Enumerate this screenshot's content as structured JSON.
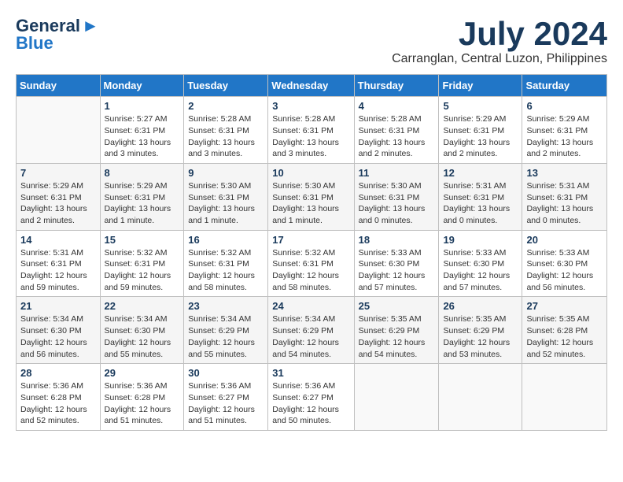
{
  "header": {
    "logo_line1": "General",
    "logo_line2": "Blue",
    "month_year": "July 2024",
    "location": "Carranglan, Central Luzon, Philippines"
  },
  "days_of_week": [
    "Sunday",
    "Monday",
    "Tuesday",
    "Wednesday",
    "Thursday",
    "Friday",
    "Saturday"
  ],
  "weeks": [
    [
      {
        "day": "",
        "info": ""
      },
      {
        "day": "1",
        "info": "Sunrise: 5:27 AM\nSunset: 6:31 PM\nDaylight: 13 hours\nand 3 minutes."
      },
      {
        "day": "2",
        "info": "Sunrise: 5:28 AM\nSunset: 6:31 PM\nDaylight: 13 hours\nand 3 minutes."
      },
      {
        "day": "3",
        "info": "Sunrise: 5:28 AM\nSunset: 6:31 PM\nDaylight: 13 hours\nand 3 minutes."
      },
      {
        "day": "4",
        "info": "Sunrise: 5:28 AM\nSunset: 6:31 PM\nDaylight: 13 hours\nand 2 minutes."
      },
      {
        "day": "5",
        "info": "Sunrise: 5:29 AM\nSunset: 6:31 PM\nDaylight: 13 hours\nand 2 minutes."
      },
      {
        "day": "6",
        "info": "Sunrise: 5:29 AM\nSunset: 6:31 PM\nDaylight: 13 hours\nand 2 minutes."
      }
    ],
    [
      {
        "day": "7",
        "info": "Sunrise: 5:29 AM\nSunset: 6:31 PM\nDaylight: 13 hours\nand 2 minutes."
      },
      {
        "day": "8",
        "info": "Sunrise: 5:29 AM\nSunset: 6:31 PM\nDaylight: 13 hours\nand 1 minute."
      },
      {
        "day": "9",
        "info": "Sunrise: 5:30 AM\nSunset: 6:31 PM\nDaylight: 13 hours\nand 1 minute."
      },
      {
        "day": "10",
        "info": "Sunrise: 5:30 AM\nSunset: 6:31 PM\nDaylight: 13 hours\nand 1 minute."
      },
      {
        "day": "11",
        "info": "Sunrise: 5:30 AM\nSunset: 6:31 PM\nDaylight: 13 hours\nand 0 minutes."
      },
      {
        "day": "12",
        "info": "Sunrise: 5:31 AM\nSunset: 6:31 PM\nDaylight: 13 hours\nand 0 minutes."
      },
      {
        "day": "13",
        "info": "Sunrise: 5:31 AM\nSunset: 6:31 PM\nDaylight: 13 hours\nand 0 minutes."
      }
    ],
    [
      {
        "day": "14",
        "info": "Sunrise: 5:31 AM\nSunset: 6:31 PM\nDaylight: 12 hours\nand 59 minutes."
      },
      {
        "day": "15",
        "info": "Sunrise: 5:32 AM\nSunset: 6:31 PM\nDaylight: 12 hours\nand 59 minutes."
      },
      {
        "day": "16",
        "info": "Sunrise: 5:32 AM\nSunset: 6:31 PM\nDaylight: 12 hours\nand 58 minutes."
      },
      {
        "day": "17",
        "info": "Sunrise: 5:32 AM\nSunset: 6:31 PM\nDaylight: 12 hours\nand 58 minutes."
      },
      {
        "day": "18",
        "info": "Sunrise: 5:33 AM\nSunset: 6:30 PM\nDaylight: 12 hours\nand 57 minutes."
      },
      {
        "day": "19",
        "info": "Sunrise: 5:33 AM\nSunset: 6:30 PM\nDaylight: 12 hours\nand 57 minutes."
      },
      {
        "day": "20",
        "info": "Sunrise: 5:33 AM\nSunset: 6:30 PM\nDaylight: 12 hours\nand 56 minutes."
      }
    ],
    [
      {
        "day": "21",
        "info": "Sunrise: 5:34 AM\nSunset: 6:30 PM\nDaylight: 12 hours\nand 56 minutes."
      },
      {
        "day": "22",
        "info": "Sunrise: 5:34 AM\nSunset: 6:30 PM\nDaylight: 12 hours\nand 55 minutes."
      },
      {
        "day": "23",
        "info": "Sunrise: 5:34 AM\nSunset: 6:29 PM\nDaylight: 12 hours\nand 55 minutes."
      },
      {
        "day": "24",
        "info": "Sunrise: 5:34 AM\nSunset: 6:29 PM\nDaylight: 12 hours\nand 54 minutes."
      },
      {
        "day": "25",
        "info": "Sunrise: 5:35 AM\nSunset: 6:29 PM\nDaylight: 12 hours\nand 54 minutes."
      },
      {
        "day": "26",
        "info": "Sunrise: 5:35 AM\nSunset: 6:29 PM\nDaylight: 12 hours\nand 53 minutes."
      },
      {
        "day": "27",
        "info": "Sunrise: 5:35 AM\nSunset: 6:28 PM\nDaylight: 12 hours\nand 52 minutes."
      }
    ],
    [
      {
        "day": "28",
        "info": "Sunrise: 5:36 AM\nSunset: 6:28 PM\nDaylight: 12 hours\nand 52 minutes."
      },
      {
        "day": "29",
        "info": "Sunrise: 5:36 AM\nSunset: 6:28 PM\nDaylight: 12 hours\nand 51 minutes."
      },
      {
        "day": "30",
        "info": "Sunrise: 5:36 AM\nSunset: 6:27 PM\nDaylight: 12 hours\nand 51 minutes."
      },
      {
        "day": "31",
        "info": "Sunrise: 5:36 AM\nSunset: 6:27 PM\nDaylight: 12 hours\nand 50 minutes."
      },
      {
        "day": "",
        "info": ""
      },
      {
        "day": "",
        "info": ""
      },
      {
        "day": "",
        "info": ""
      }
    ]
  ]
}
